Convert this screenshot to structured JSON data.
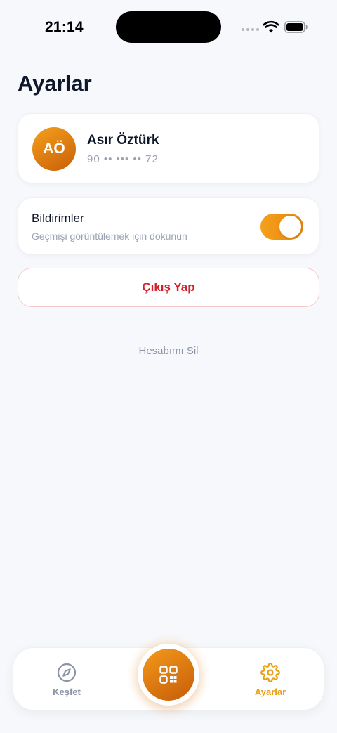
{
  "status_bar": {
    "time": "21:14",
    "icons": [
      "signal-dots-icon",
      "wifi-icon",
      "battery-icon"
    ]
  },
  "page": {
    "title": "Ayarlar"
  },
  "profile": {
    "initials": "AÖ",
    "name": "Asır Öztürk",
    "phone": "90 •• ••• •• 72"
  },
  "notifications": {
    "title": "Bildirimler",
    "subtitle": "Geçmişi görüntülemek için dokunun",
    "enabled": true
  },
  "actions": {
    "logout_label": "Çıkış Yap",
    "delete_account_label": "Hesabımı Sil"
  },
  "bottom_nav": {
    "items": [
      {
        "label": "Keşfet",
        "icon": "compass-icon",
        "active": false
      },
      {
        "label": "Ayarlar",
        "icon": "gear-icon",
        "active": true
      }
    ],
    "center_action_icon": "qr-code-icon"
  },
  "colors": {
    "accent": "#F39A1B",
    "accent_dark": "#C65C08",
    "danger": "#D4202A",
    "muted": "#8A94A6",
    "background": "#F7F8FB"
  }
}
